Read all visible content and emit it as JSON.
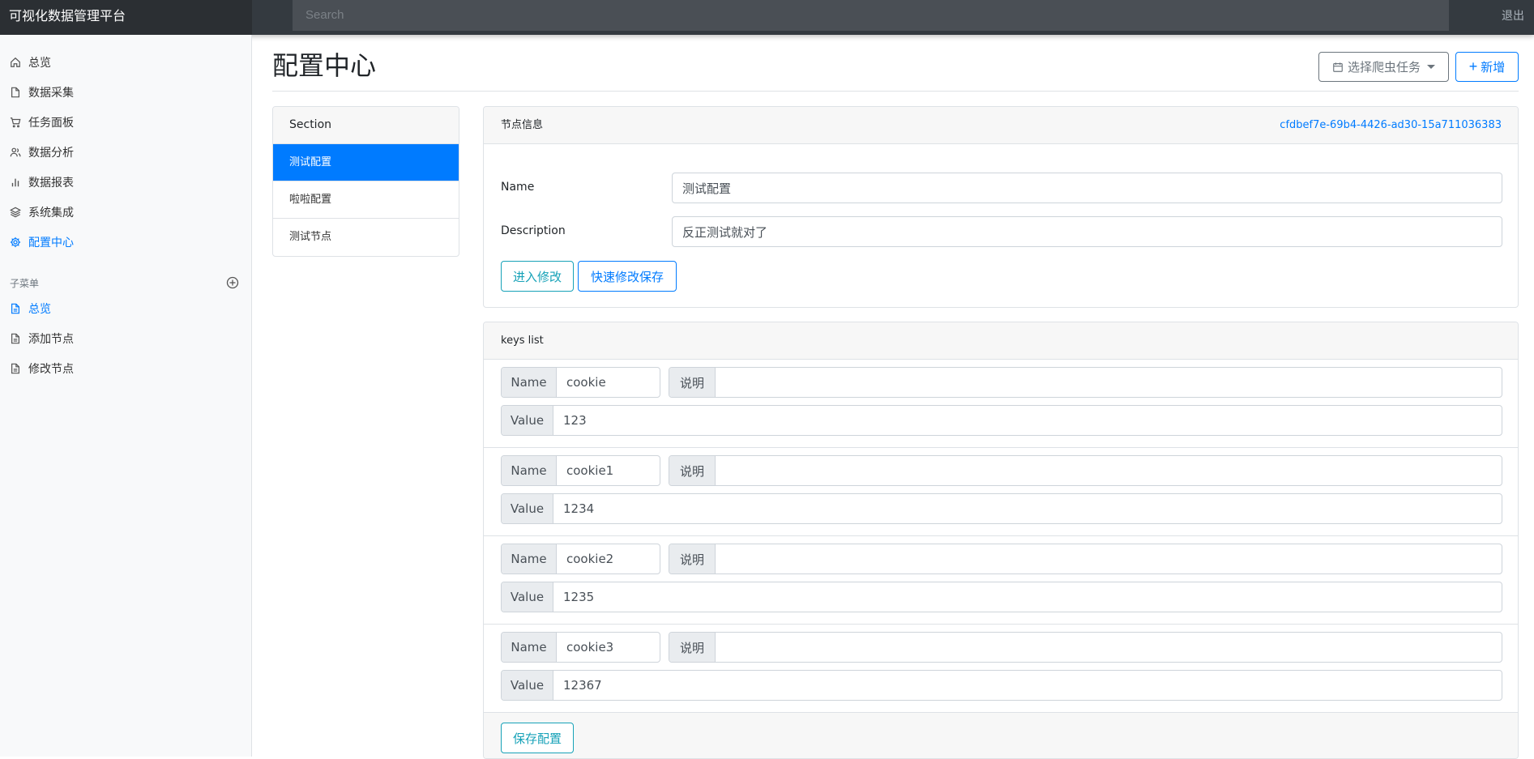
{
  "app": {
    "title": "可视化数据管理平台",
    "search_placeholder": "Search",
    "logout": "退出"
  },
  "sidebar": {
    "items": [
      {
        "label": "总览",
        "icon": "home-icon"
      },
      {
        "label": "数据采集",
        "icon": "file-icon"
      },
      {
        "label": "任务面板",
        "icon": "cart-icon"
      },
      {
        "label": "数据分析",
        "icon": "users-icon"
      },
      {
        "label": "数据报表",
        "icon": "bar-chart-icon"
      },
      {
        "label": "系统集成",
        "icon": "layers-icon"
      },
      {
        "label": "配置中心",
        "icon": "gear-icon",
        "active": true
      }
    ],
    "submenu_heading": "子菜单",
    "submenu": [
      {
        "label": "总览",
        "icon": "file-text-icon",
        "active": true
      },
      {
        "label": "添加节点",
        "icon": "file-text-icon"
      },
      {
        "label": "修改节点",
        "icon": "file-text-icon"
      }
    ]
  },
  "main": {
    "title": "配置中心",
    "select_task_label": "选择爬虫任务",
    "new_label": "新增",
    "sections": {
      "header": "Section",
      "items": [
        {
          "label": "测试配置",
          "active": true
        },
        {
          "label": "啦啦配置"
        },
        {
          "label": "测试节点"
        }
      ]
    },
    "node": {
      "header": "节点信息",
      "id": "cfdbef7e-69b4-4426-ad30-15a711036383",
      "name_label": "Name",
      "name_value": "测试配置",
      "description_label": "Description",
      "description_value": "反正测试就对了",
      "enter_edit_label": "进入修改",
      "quick_save_label": "快速修改保存"
    },
    "keys": {
      "header": "keys list",
      "name_addon": "Name",
      "desc_addon": "说明",
      "value_addon": "Value",
      "rows": [
        {
          "name": "cookie",
          "desc": "",
          "value": "123"
        },
        {
          "name": "cookie1",
          "desc": "",
          "value": "1234"
        },
        {
          "name": "cookie2",
          "desc": "",
          "value": "1235"
        },
        {
          "name": "cookie3",
          "desc": "",
          "value": "12367"
        }
      ],
      "save_label": "保存配置"
    }
  },
  "colors": {
    "primary": "#007bff",
    "info": "#17a2b8",
    "topbar": "#343a40"
  }
}
